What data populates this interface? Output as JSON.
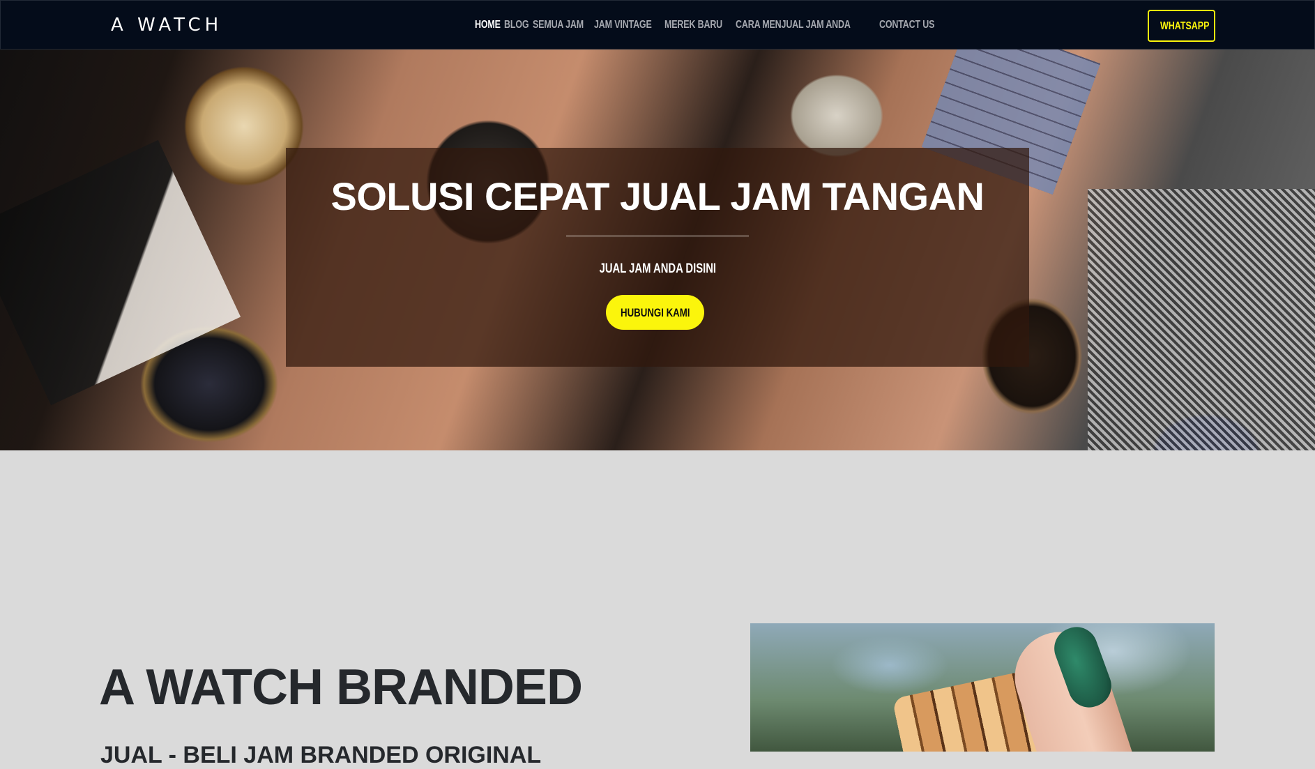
{
  "navbar": {
    "brand": "A WATCH",
    "links": [
      {
        "label": "HOME",
        "active": true
      },
      {
        "label": "BLOG",
        "active": false
      },
      {
        "label": "SEMUA JAM",
        "active": false
      },
      {
        "label": "JAM VINTAGE",
        "active": false
      },
      {
        "label": "MEREK BARU",
        "active": false
      },
      {
        "label": "CARA MENJUAL JAM ANDA",
        "active": false
      },
      {
        "label": "CONTACT US",
        "active": false
      }
    ],
    "cta": "WHATSAPP"
  },
  "hero": {
    "title": "SOLUSI CEPAT JUAL JAM TANGAN",
    "subtitle": "JUAL JAM ANDA DISINI",
    "button": "HUBUNGI KAMI"
  },
  "about": {
    "title": "A WATCH BRANDED",
    "subtitle": "JUAL - BELI JAM BRANDED ORIGINAL"
  },
  "colors": {
    "nav_bg": "#040c1a",
    "accent_yellow": "#fbf50c",
    "page_bg": "#dadada",
    "heading_dark": "#25282c"
  }
}
